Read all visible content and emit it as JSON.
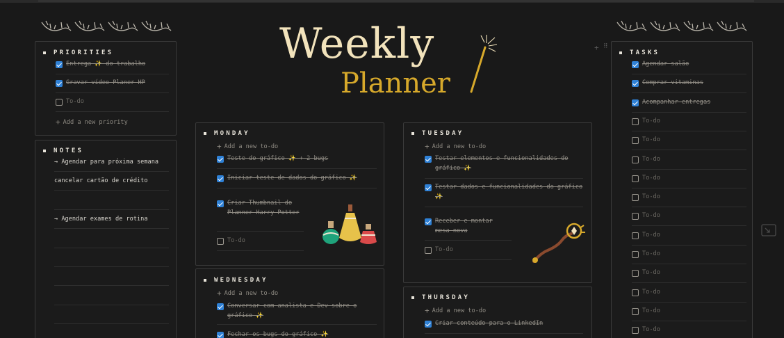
{
  "header": {
    "title_line1": "Weekly",
    "title_line2": "Planner"
  },
  "priorities": {
    "title": "PRIORITIES",
    "items": [
      {
        "label": "Entrega ✨ do trabalho",
        "checked": true
      },
      {
        "label": "Gravar vídeo Planer HP",
        "checked": true
      },
      {
        "label": "To-do",
        "checked": false
      }
    ],
    "add_label": "Add a new priority"
  },
  "notes": {
    "title": "NOTES",
    "items": [
      "→ Agendar para próxima semana",
      "cancelar cartão de crédito",
      "→ Agendar exames de rotina"
    ]
  },
  "monday": {
    "title": "MONDAY",
    "add_label": "Add a new to-do",
    "items": [
      {
        "label": "Teste do gráfico ✨ + 2 bugs",
        "checked": true
      },
      {
        "label": "Iniciar teste de dados do gráfico ✨",
        "checked": true
      },
      {
        "label": "Criar Thumbnail do Planner Harry Potter",
        "checked": true
      },
      {
        "label": "To-do",
        "checked": false
      }
    ]
  },
  "tuesday": {
    "title": "TUESDAY",
    "add_label": "Add a new to-do",
    "items": [
      {
        "label": "Testar elementos e funcionalidades do gráfico ✨",
        "checked": true
      },
      {
        "label": "Testar dados e funcionalidades do gráfico ✨",
        "checked": true
      },
      {
        "label": "Receber e montar mesa nova",
        "checked": true
      },
      {
        "label": "To-do",
        "checked": false
      }
    ]
  },
  "wednesday": {
    "title": "WEDNESDAY",
    "add_label": "Add a new to-do",
    "items": [
      {
        "label": "Conversar com analista e Dev sobre o gráfico ✨",
        "checked": true
      },
      {
        "label": "Fechar os bugs do gráfico ✨",
        "checked": true
      }
    ]
  },
  "thursday": {
    "title": "THURSDAY",
    "add_label": "Add a new to-do",
    "items": [
      {
        "label": "Criar conteúdo para o LinkedIn",
        "checked": true
      }
    ]
  },
  "tasks": {
    "title": "TASKS",
    "items": [
      {
        "label": "Agendar salão",
        "checked": true
      },
      {
        "label": "Comprar vitaminas",
        "checked": true
      },
      {
        "label": "Acompanhar entregas",
        "checked": true
      },
      {
        "label": "To-do",
        "checked": false
      },
      {
        "label": "To-do",
        "checked": false
      },
      {
        "label": "To-do",
        "checked": false
      },
      {
        "label": "To-do",
        "checked": false
      },
      {
        "label": "To-do",
        "checked": false
      },
      {
        "label": "To-do",
        "checked": false
      },
      {
        "label": "To-do",
        "checked": false
      },
      {
        "label": "To-do",
        "checked": false
      },
      {
        "label": "To-do",
        "checked": false
      },
      {
        "label": "To-do",
        "checked": false
      },
      {
        "label": "To-do",
        "checked": false
      },
      {
        "label": "To-do",
        "checked": false
      }
    ]
  },
  "colors": {
    "background": "#191919",
    "checkbox": "#2f81d6",
    "title_cream": "#f2e3bc",
    "title_gold": "#d7a92b"
  }
}
